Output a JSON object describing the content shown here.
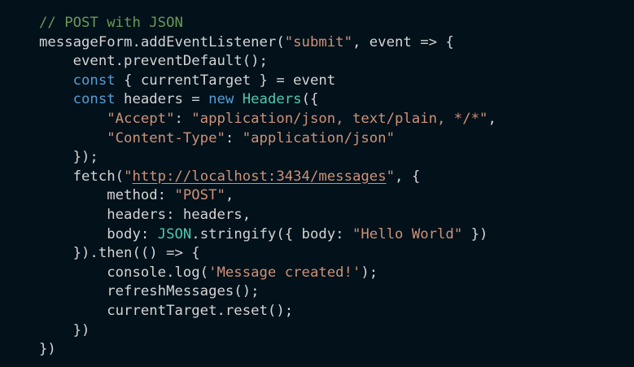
{
  "editor": {
    "lines": [
      {
        "indent": 0,
        "tokens": [
          {
            "t": "// POST with JSON",
            "k": "comment"
          }
        ]
      },
      {
        "indent": 0,
        "tokens": [
          {
            "t": "messageForm.addEventListener(",
            "k": "plain"
          },
          {
            "t": "\"submit\"",
            "k": "string"
          },
          {
            "t": ", event => {",
            "k": "plain"
          }
        ]
      },
      {
        "indent": 1,
        "tokens": [
          {
            "t": "event.preventDefault();",
            "k": "plain"
          }
        ]
      },
      {
        "indent": 1,
        "tokens": [
          {
            "t": "const",
            "k": "keyword"
          },
          {
            "t": " { currentTarget } = event",
            "k": "plain"
          }
        ]
      },
      {
        "indent": 1,
        "tokens": [
          {
            "t": "const",
            "k": "keyword"
          },
          {
            "t": " headers = ",
            "k": "plain"
          },
          {
            "t": "new",
            "k": "keyword"
          },
          {
            "t": " ",
            "k": "plain"
          },
          {
            "t": "Headers",
            "k": "type"
          },
          {
            "t": "({",
            "k": "plain"
          }
        ]
      },
      {
        "indent": 2,
        "tokens": [
          {
            "t": "\"Accept\"",
            "k": "string"
          },
          {
            "t": ": ",
            "k": "plain"
          },
          {
            "t": "\"application/json, text/plain, */*\"",
            "k": "string"
          },
          {
            "t": ",",
            "k": "plain"
          }
        ]
      },
      {
        "indent": 2,
        "tokens": [
          {
            "t": "\"Content-Type\"",
            "k": "string"
          },
          {
            "t": ": ",
            "k": "plain"
          },
          {
            "t": "\"application/json\"",
            "k": "string"
          }
        ]
      },
      {
        "indent": 1,
        "tokens": [
          {
            "t": "});",
            "k": "plain"
          }
        ]
      },
      {
        "indent": 1,
        "tokens": [
          {
            "t": "fetch(",
            "k": "plain"
          },
          {
            "t": "\"",
            "k": "string"
          },
          {
            "t": "http://localhost:3434/messages",
            "k": "link"
          },
          {
            "t": "\"",
            "k": "string"
          },
          {
            "t": ", {",
            "k": "plain"
          }
        ]
      },
      {
        "indent": 2,
        "tokens": [
          {
            "t": "method: ",
            "k": "plain"
          },
          {
            "t": "\"POST\"",
            "k": "string"
          },
          {
            "t": ",",
            "k": "plain"
          }
        ]
      },
      {
        "indent": 2,
        "tokens": [
          {
            "t": "headers: headers,",
            "k": "plain"
          }
        ]
      },
      {
        "indent": 2,
        "tokens": [
          {
            "t": "body: ",
            "k": "plain"
          },
          {
            "t": "JSON",
            "k": "type"
          },
          {
            "t": ".stringify({ body: ",
            "k": "plain"
          },
          {
            "t": "\"Hello World\"",
            "k": "string"
          },
          {
            "t": " })",
            "k": "plain"
          }
        ]
      },
      {
        "indent": 1,
        "tokens": [
          {
            "t": "}).then(() => {",
            "k": "plain"
          }
        ]
      },
      {
        "indent": 2,
        "tokens": [
          {
            "t": "console.log(",
            "k": "plain"
          },
          {
            "t": "'Message created!'",
            "k": "string"
          },
          {
            "t": ");",
            "k": "plain"
          }
        ]
      },
      {
        "indent": 2,
        "tokens": [
          {
            "t": "refreshMessages();",
            "k": "plain"
          }
        ]
      },
      {
        "indent": 2,
        "tokens": [
          {
            "t": "currentTarget.reset();",
            "k": "plain"
          }
        ]
      },
      {
        "indent": 1,
        "tokens": [
          {
            "t": "})",
            "k": "plain"
          }
        ]
      },
      {
        "indent": 0,
        "tokens": [
          {
            "t": "})",
            "k": "plain"
          }
        ]
      }
    ],
    "colors": {
      "background": "#02111a",
      "plain": "#d4d4d4",
      "comment": "#6a9955",
      "string": "#ce9178",
      "keyword": "#569cd6",
      "type": "#4ec9b0"
    }
  }
}
